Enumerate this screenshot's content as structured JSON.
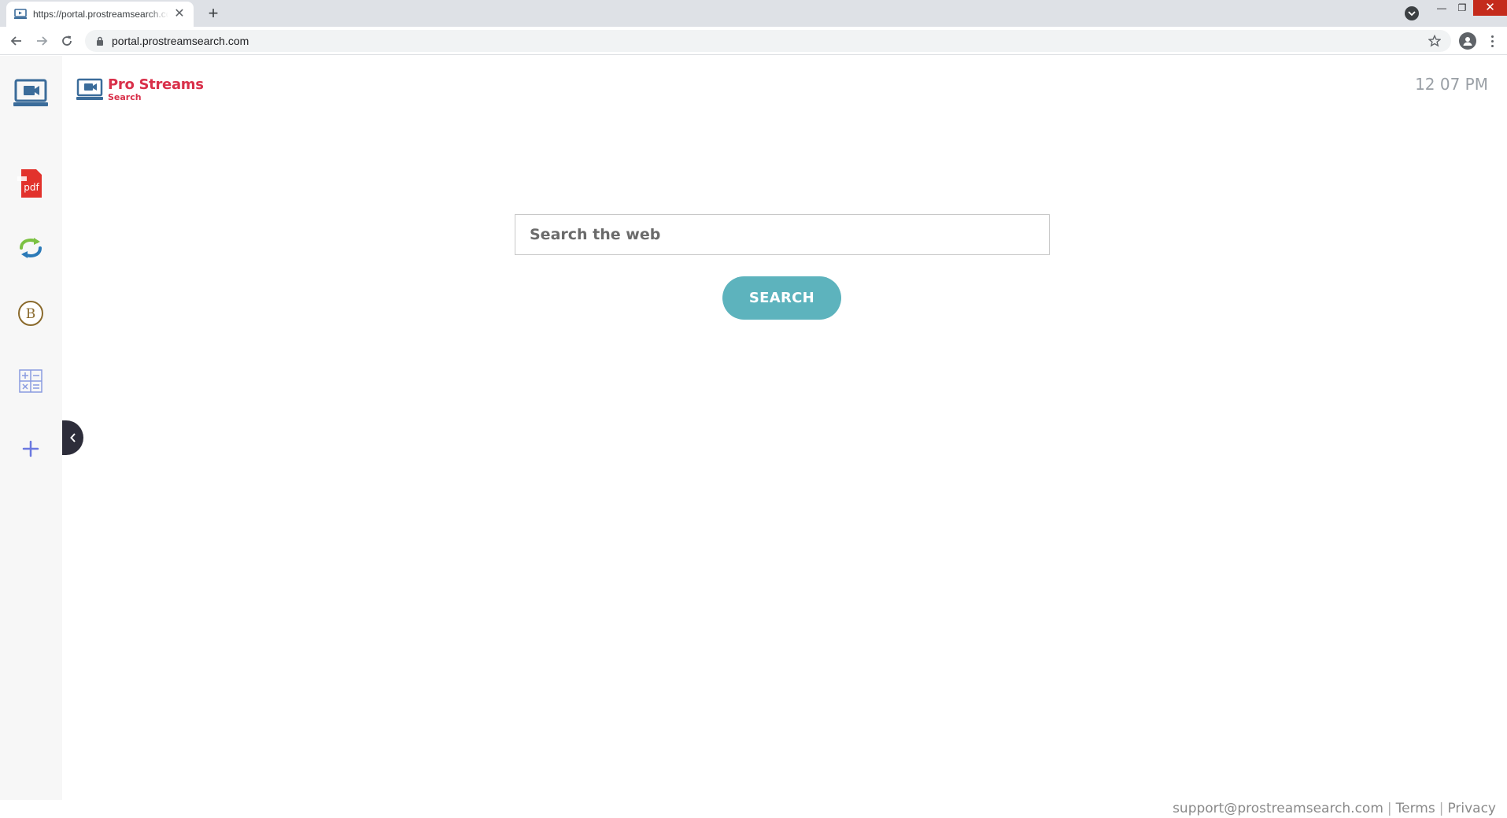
{
  "browser": {
    "tab_title": "https://portal.prostreamsearch.com",
    "url": "portal.prostreamsearch.com"
  },
  "header": {
    "logo_main": "Pro Streams",
    "logo_sub": "Search",
    "time": "12 07 PM"
  },
  "search": {
    "placeholder": "Search the web",
    "button_label": "SEARCH"
  },
  "sidebar": {
    "items": [
      {
        "icon": "tv-play-icon"
      },
      {
        "icon": "pdf-icon"
      },
      {
        "icon": "convert-arrows-icon"
      },
      {
        "icon": "bitcoin-icon"
      },
      {
        "icon": "calculator-icon"
      },
      {
        "icon": "plus-icon"
      }
    ],
    "pdf_label": "pdf",
    "bitcoin_label": "B"
  },
  "footer": {
    "email": "support@prostreamsearch.com",
    "terms": "Terms",
    "privacy": "Privacy",
    "separator": "|"
  },
  "colors": {
    "brand_red": "#d9304a",
    "button_teal": "#5db3bd",
    "logo_blue": "#3b6c9a",
    "sidebar_bg": "#f7f7f7"
  }
}
